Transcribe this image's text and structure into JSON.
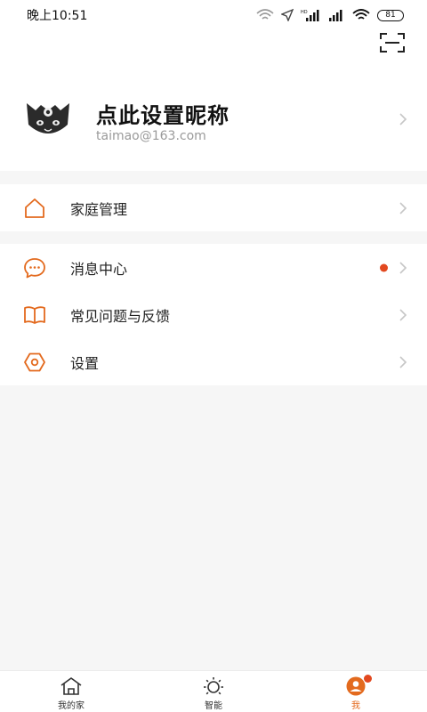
{
  "status_bar": {
    "time": "晚上10:51",
    "battery": "81"
  },
  "header": {
    "scan_icon": "scan-icon",
    "nickname": "点此设置昵称",
    "email": "taimao@163.com"
  },
  "menu": {
    "family": {
      "label": "家庭管理",
      "icon": "home-outline-icon"
    },
    "messages": {
      "label": "消息中心",
      "icon": "chat-bubble-icon",
      "has_unread": true
    },
    "faq": {
      "label": "常见问题与反馈",
      "icon": "book-icon"
    },
    "settings": {
      "label": "设置",
      "icon": "hexagon-settings-icon"
    }
  },
  "tabbar": {
    "tabs": [
      {
        "label": "我的家",
        "icon": "house-icon",
        "active": false
      },
      {
        "label": "智能",
        "icon": "sun-icon",
        "active": false
      },
      {
        "label": "我",
        "icon": "user-icon",
        "active": true
      }
    ]
  },
  "colors": {
    "accent": "#e36a1e",
    "badge": "#e2481f",
    "background": "#f6f6f6"
  }
}
